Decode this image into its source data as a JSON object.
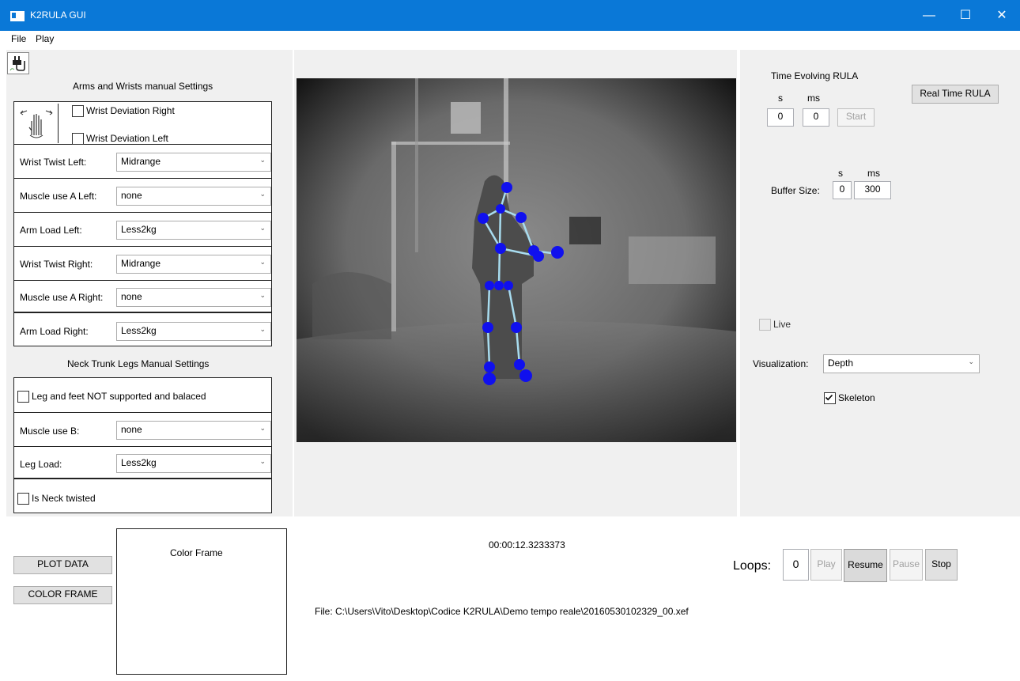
{
  "window": {
    "title": "K2RULA GUI",
    "minimize": "—",
    "maximize": "☐",
    "close": "✕",
    "title_color": "#0a78d7"
  },
  "menu": {
    "file": "File",
    "play": "Play"
  },
  "left": {
    "arms_title": "Arms and Wrists manual Settings",
    "wrist_dev_right": "Wrist Deviation Right",
    "wrist_dev_left": "Wrist Deviation Left",
    "rows": [
      {
        "label": "Wrist Twist Left:",
        "value": "Midrange"
      },
      {
        "label": "Muscle use A Left:",
        "value": "none"
      },
      {
        "label": "Arm Load Left:",
        "value": "Less2kg"
      },
      {
        "label": "Wrist Twist Right:",
        "value": "Midrange"
      },
      {
        "label": "Muscle use A Right:",
        "value": "none"
      },
      {
        "label": "Arm Load Right:",
        "value": "Less2kg"
      }
    ],
    "neck_title": "Neck Trunk Legs Manual Settings",
    "leg_feet": "Leg and feet NOT supported and balaced",
    "muscle_b": {
      "label": "Muscle use B:",
      "value": "none"
    },
    "leg_load": {
      "label": "Leg Load:",
      "value": "Less2kg"
    },
    "neck_twisted": "Is Neck twisted"
  },
  "right": {
    "time_evolving": "Time Evolving RULA",
    "s_label": "s",
    "ms_label": "ms",
    "s_value": "0",
    "ms_value": "0",
    "start": "Start",
    "real_time": "Real Time RULA",
    "buffer_label": "Buffer Size:",
    "buffer_s_label": "s",
    "buffer_ms_label": "ms",
    "buffer_s": "0",
    "buffer_ms": "300",
    "live": "Live",
    "visualization_label": "Visualization:",
    "visualization_value": "Depth",
    "skeleton": "Skeleton",
    "skeleton_checked": true
  },
  "bottom": {
    "plot_data": "PLOT DATA",
    "color_frame_btn": "COLOR FRAME",
    "color_frame_title": "Color Frame",
    "timestamp": "00:00:12.3233373",
    "file_path": "File: C:\\Users\\Vito\\Desktop\\Codice K2RULA\\Demo tempo reale\\20160530102329_00.xef",
    "loops_label": "Loops:",
    "loops_value": "0",
    "play": "Play",
    "resume": "Resume",
    "pause": "Pause",
    "stop": "Stop"
  }
}
